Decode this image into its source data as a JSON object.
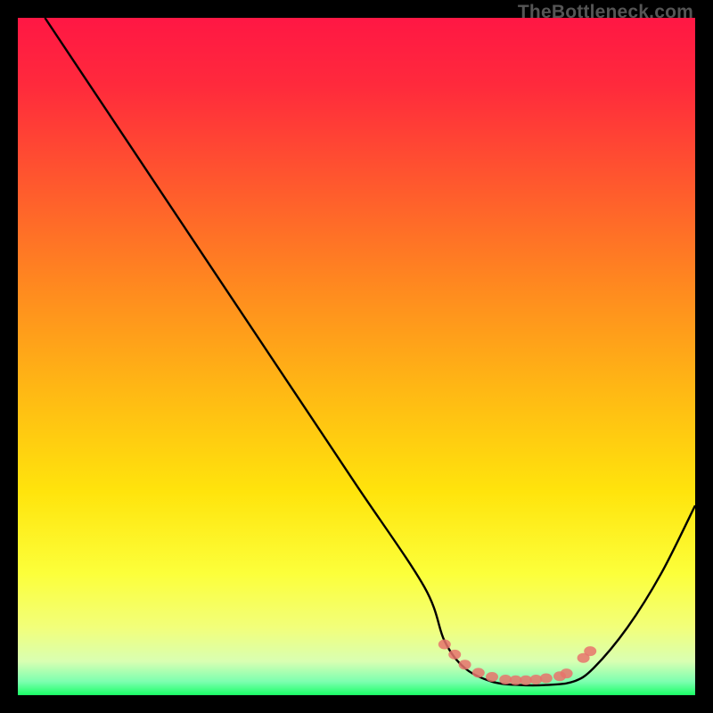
{
  "watermark": "TheBottleneck.com",
  "chart_data": {
    "type": "line",
    "title": "",
    "xlabel": "",
    "ylabel": "",
    "xlim": [
      0,
      100
    ],
    "ylim": [
      0,
      100
    ],
    "grid": false,
    "series": [
      {
        "name": "curve",
        "color": "#000000",
        "x": [
          4,
          10,
          20,
          30,
          40,
          50,
          60,
          63,
          66,
          70,
          74,
          78,
          82,
          85,
          90,
          95,
          100
        ],
        "y": [
          100,
          91,
          76,
          61,
          46,
          31,
          16,
          8,
          4,
          2,
          1.5,
          1.5,
          2,
          4,
          10,
          18,
          28
        ]
      },
      {
        "name": "highlight-dots",
        "type": "scatter",
        "color": "#e8736c",
        "points": [
          {
            "x": 63,
            "y": 7.5
          },
          {
            "x": 64.5,
            "y": 6
          },
          {
            "x": 66,
            "y": 4.5
          },
          {
            "x": 68,
            "y": 3.3
          },
          {
            "x": 70,
            "y": 2.7
          },
          {
            "x": 72,
            "y": 2.3
          },
          {
            "x": 73.5,
            "y": 2.2
          },
          {
            "x": 75,
            "y": 2.2
          },
          {
            "x": 76.5,
            "y": 2.3
          },
          {
            "x": 78,
            "y": 2.5
          },
          {
            "x": 80,
            "y": 2.8
          },
          {
            "x": 81,
            "y": 3.2
          },
          {
            "x": 83.5,
            "y": 5.5
          },
          {
            "x": 84.5,
            "y": 6.5
          }
        ]
      }
    ],
    "gradient_stops": [
      {
        "offset": 0,
        "color": "#ff1744"
      },
      {
        "offset": 10,
        "color": "#ff2a3c"
      },
      {
        "offset": 25,
        "color": "#ff5a2d"
      },
      {
        "offset": 40,
        "color": "#ff8a1f"
      },
      {
        "offset": 55,
        "color": "#ffb814"
      },
      {
        "offset": 70,
        "color": "#ffe40c"
      },
      {
        "offset": 82,
        "color": "#fcff3a"
      },
      {
        "offset": 90,
        "color": "#f2ff7a"
      },
      {
        "offset": 95,
        "color": "#d9ffb2"
      },
      {
        "offset": 98,
        "color": "#7dffb0"
      },
      {
        "offset": 100,
        "color": "#1aff66"
      }
    ]
  }
}
